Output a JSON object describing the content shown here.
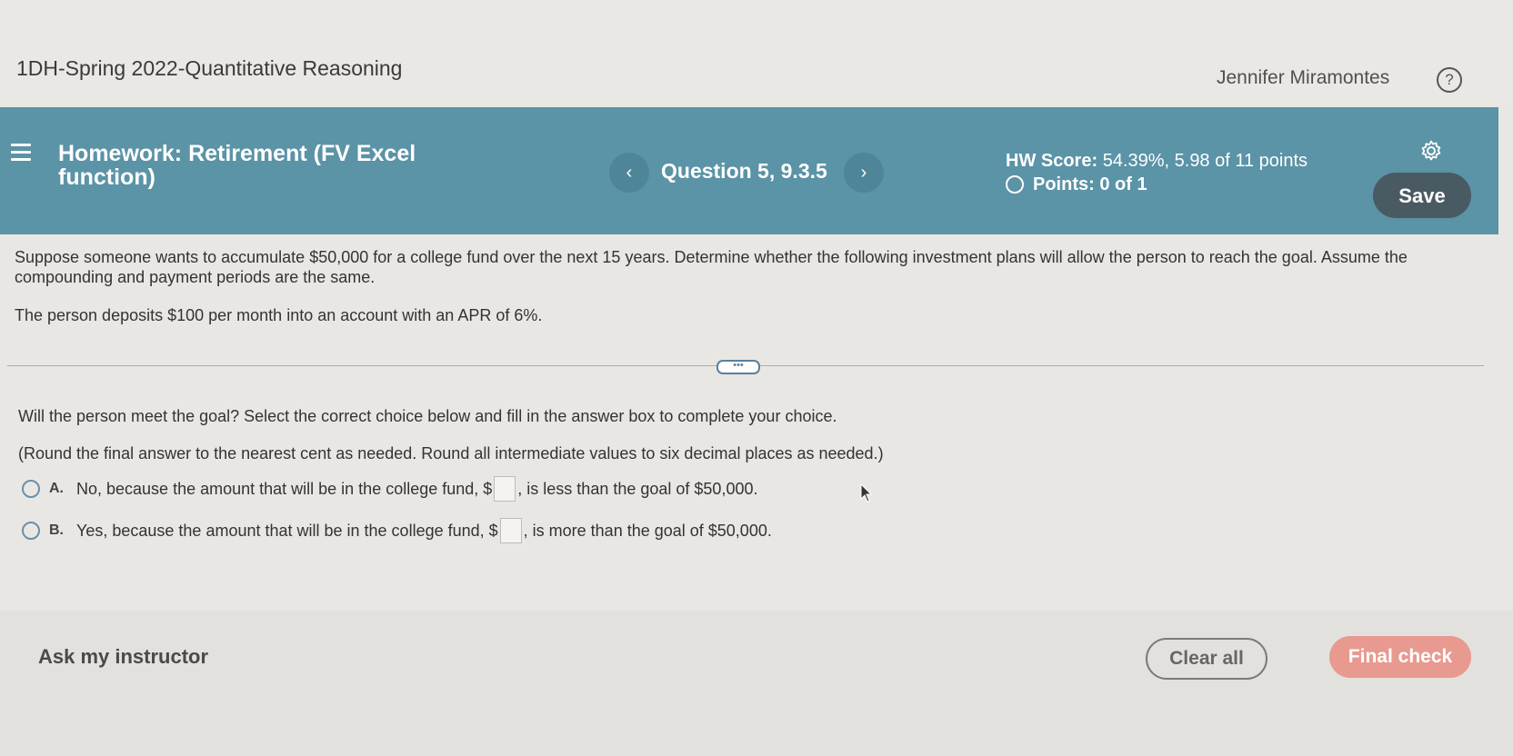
{
  "topbar": {
    "course_title": "1DH-Spring 2022-Quantitative Reasoning",
    "user_name": "Jennifer Miramontes",
    "help_symbol": "?"
  },
  "header": {
    "title": "Homework: Retirement (FV Excel function)",
    "question_label": "Question 5, 9.3.5",
    "prev_symbol": "‹",
    "next_symbol": "›",
    "hw_score_label": "HW Score:",
    "hw_score_value": "54.39%, 5.98 of 11 points",
    "points_label": "Points: 0 of 1",
    "save_label": "Save",
    "accent_color": "#5b93a7"
  },
  "problem": {
    "paragraph1": "Suppose someone wants to accumulate $50,000 for a college fund over the next 15 years. Determine whether the following investment plans will allow the person to reach the goal. Assume the compounding and payment periods are the same.",
    "paragraph2": "The person deposits $100 per month into an account with an APR of 6%."
  },
  "divider": {
    "more_symbol": "•••"
  },
  "question": {
    "prompt": "Will the person meet the goal? Select the correct choice below and fill in the answer box to complete your choice.",
    "instruction": "(Round the final answer to the nearest cent as needed. Round all intermediate values to six decimal places as needed.)",
    "choices": [
      {
        "letter": "A.",
        "text_before": "No, because the amount that will be in the college fund, $",
        "text_after": ", is less than the goal of $50,000."
      },
      {
        "letter": "B.",
        "text_before": "Yes, because the amount that will be in the college fund, $",
        "text_after": ", is more than the goal of $50,000."
      }
    ]
  },
  "footer": {
    "ask_label": "Ask my instructor",
    "clear_label": "Clear all",
    "final_label": "Final check"
  }
}
